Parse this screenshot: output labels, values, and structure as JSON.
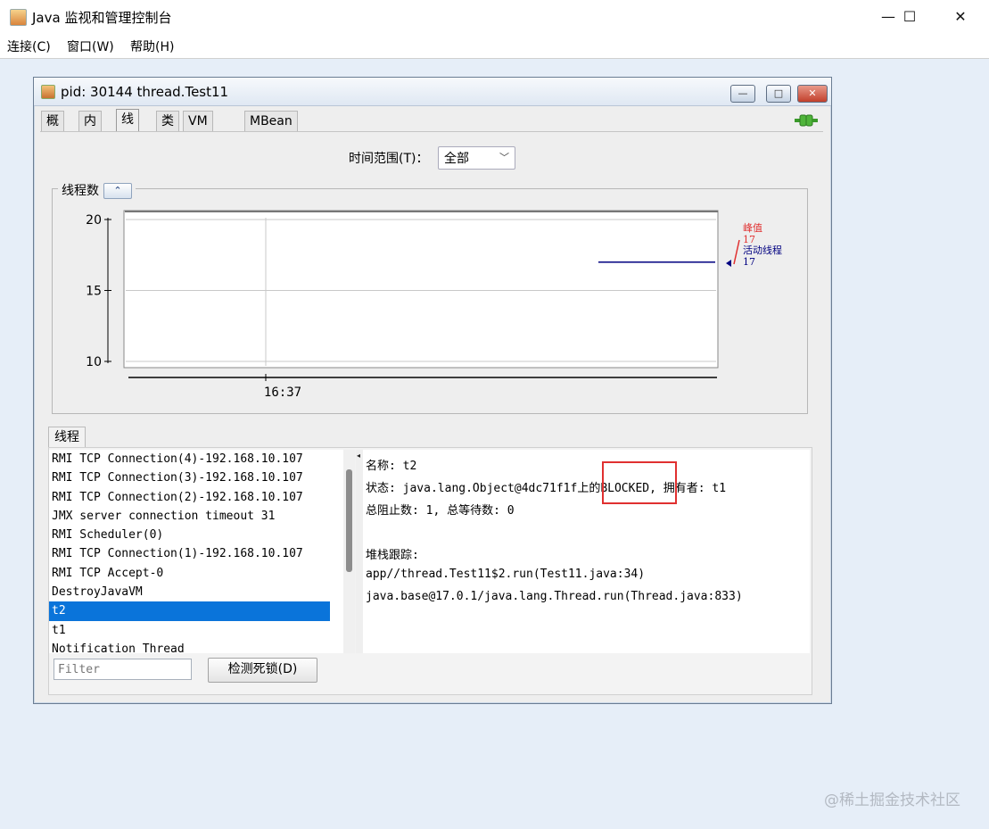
{
  "window": {
    "title": "Java 监视和管理控制台",
    "controls": {
      "minimize": "—",
      "maximize": "☐",
      "close": "✕"
    }
  },
  "menu": [
    "连接(C)",
    "窗口(W)",
    "帮助(H)"
  ],
  "frame": {
    "title": "pid: 30144 thread.Test11",
    "tabs": [
      "概览",
      "内存",
      "线程",
      "类",
      "VM 概要",
      "MBean"
    ],
    "active_tab": "线程"
  },
  "time_range": {
    "label": "时间范围(T)：",
    "value": "全部"
  },
  "chart_group": {
    "title": "线程数",
    "collapse_glyph": "⌃"
  },
  "chart_data": {
    "type": "line",
    "title": "",
    "xlabel": "",
    "ylabel": "",
    "ylim": [
      10,
      20
    ],
    "y_ticks": [
      20,
      15,
      10
    ],
    "x_ticks": [
      "16:37"
    ],
    "series": [
      {
        "name": "峰值",
        "color": "#cc0000",
        "values": [
          17,
          17
        ]
      },
      {
        "name": "活动线程",
        "color": "#000080",
        "values": [
          17,
          17
        ]
      }
    ],
    "legend": [
      {
        "label": "峰值",
        "value": "17",
        "color": "#e03030"
      },
      {
        "label": "活动线程",
        "value": "17",
        "color": "#000080"
      }
    ],
    "legend_position": "right"
  },
  "threads_section": {
    "tab": "线程",
    "list": [
      "RMI TCP Connection(4)-192.168.10.107",
      "RMI TCP Connection(3)-192.168.10.107",
      "RMI TCP Connection(2)-192.168.10.107",
      "JMX server connection timeout 31",
      "RMI Scheduler(0)",
      "RMI TCP Connection(1)-192.168.10.107",
      "RMI TCP Accept-0",
      "DestroyJavaVM",
      "t2",
      "t1",
      "Notification Thread"
    ],
    "selected": "t2",
    "detail": {
      "name_line": "名称: t2",
      "state_line": "状态: java.lang.Object@4dc71f1f上的BLOCKED, 拥有者: t1",
      "counts_line": "总阻止数: 1, 总等待数: 0",
      "stack_header": "堆栈跟踪:",
      "stack": [
        "app//thread.Test11$2.run(Test11.java:34)",
        "java.base@17.0.1/java.lang.Thread.run(Thread.java:833)"
      ]
    },
    "filter_placeholder": "Filter",
    "deadlock_button": "检测死锁(D)"
  },
  "watermark": "@稀土掘金技术社区",
  "colors": {
    "selection": "#0a74da",
    "highlight_box": "#e03030"
  }
}
